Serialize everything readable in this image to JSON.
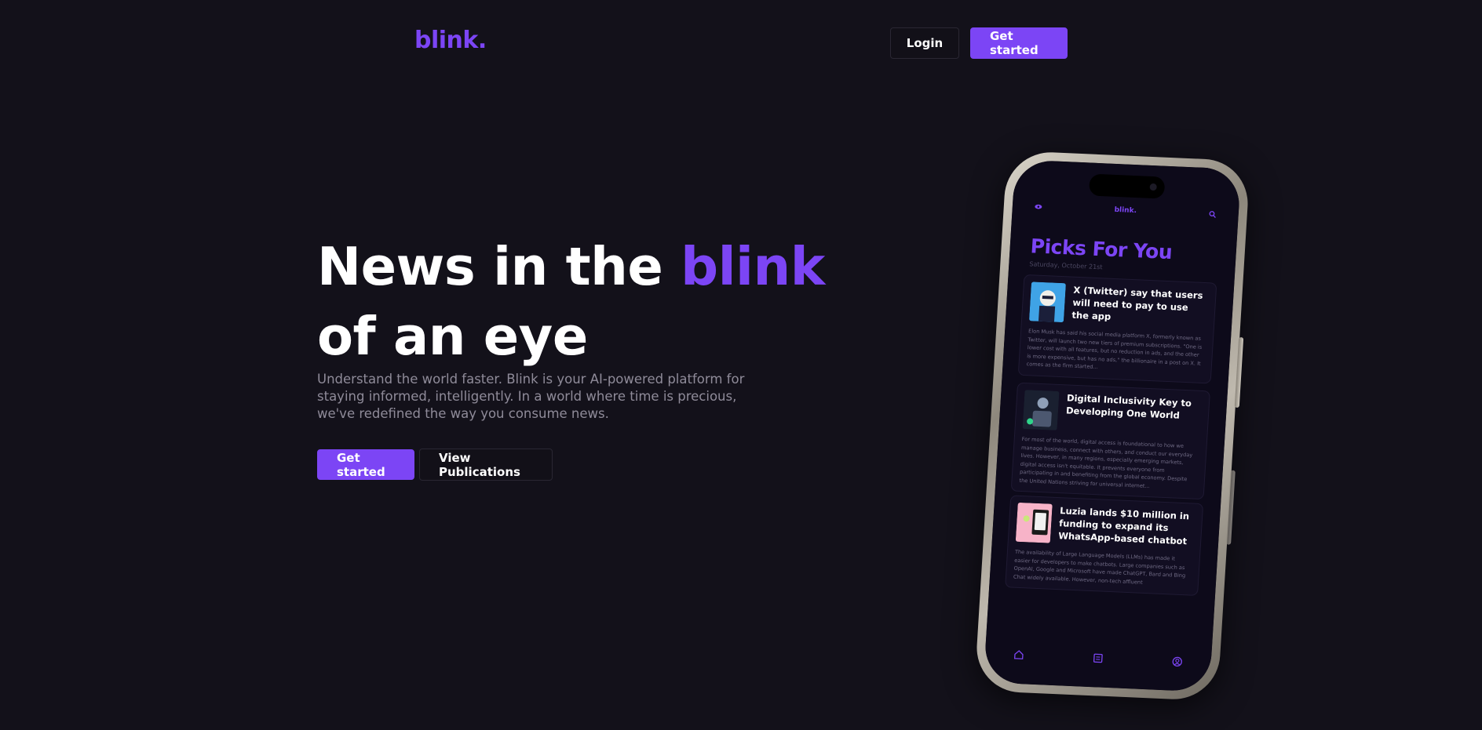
{
  "header": {
    "logo": "blink.",
    "login_label": "Login",
    "get_started_label": "Get started"
  },
  "hero": {
    "title_prefix": "News in the ",
    "title_accent": "blink",
    "title_line2": "of an eye",
    "subtitle": "Understand the world faster. Blink is your AI-powered platform for staying informed, intelligently. In a world where time is precious, we've redefined the way you consume news.",
    "primary_cta": "Get started",
    "secondary_cta": "View Publications"
  },
  "phone": {
    "app_logo": "blink.",
    "picks_title": "Picks For You",
    "date": "Saturday, October 21st",
    "articles": [
      {
        "title": "X (Twitter) say that users will need to pay to use the app",
        "body": "Elon Musk has said his social media platform X, formerly known as Twitter, will launch two new tiers of premium subscriptions. \"One is lower cost with all features, but no reduction in ads, and the other is more expensive, but has no ads,\" the billionaire in a post on X. It comes as the firm started...",
        "thumb_icon": "portrait-icon"
      },
      {
        "title": "Digital Inclusivity Key to Developing One World",
        "body": "For most of the world, digital access is foundational to how we manage business, connect with others, and conduct our everyday lives. However, in many regions, especially emerging markets, digital access isn't equitable. It prevents everyone from participating in and benefiting from the global economy. Despite the United Nations striving for universal internet...",
        "thumb_icon": "network-icon"
      },
      {
        "title": "Luzia lands $10 million in funding to expand its WhatsApp-based chatbot",
        "body": "The availability of Large Language Models (LLMs) has made it easier for developers to make chatbots. Large companies such as OpenAI, Google and Microsoft have made ChatGPT, Bard and Bing Chat widely available. However, non-tech affluent",
        "thumb_icon": "chatbot-icon"
      }
    ],
    "tabs": [
      "home-icon",
      "news-icon",
      "profile-icon"
    ]
  },
  "colors": {
    "background": "#13111a",
    "accent": "#7c45f5",
    "muted_text": "#8f8b99"
  }
}
